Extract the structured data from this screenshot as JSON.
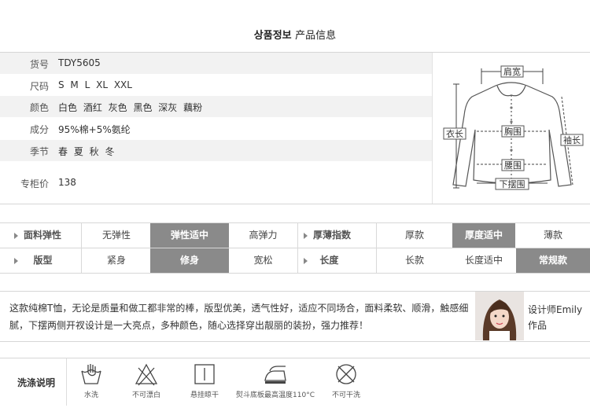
{
  "title": {
    "main": "상품정보",
    "sub": "产品信息"
  },
  "info": [
    {
      "label": "货号",
      "value": "TDY5605"
    },
    {
      "label": "尺码",
      "value": "S M L XL XXL"
    },
    {
      "label": "颜色",
      "value": "白色 酒红 灰色 黑色 深灰 藕粉"
    },
    {
      "label": "成分",
      "value": "95%棉+5%氨纶"
    },
    {
      "label": "季节",
      "value": "春 夏 秋 冬"
    },
    {
      "label": "专柜价",
      "value": "138"
    }
  ],
  "diagram": {
    "shoulder": "肩宽",
    "length": "衣长",
    "chest": "胸围",
    "sleeve": "袖长",
    "waist": "腰围",
    "hem": "下摆围"
  },
  "attributes": {
    "row1": {
      "left_head": "面料弹性",
      "left_options": [
        "无弹性",
        "弹性适中",
        "高弹力"
      ],
      "right_head": "厚薄指数",
      "right_options": [
        "厚款",
        "厚度适中",
        "薄款"
      ]
    },
    "row2": {
      "left_head": "版型",
      "left_options": [
        "紧身",
        "修身",
        "宽松"
      ],
      "right_head": "长度",
      "right_options": [
        "长款",
        "长度适中",
        "常规款"
      ]
    }
  },
  "description": {
    "text": "这款纯棉T恤，无论是质量和做工都非常的棒，版型优美，透气性好，适应不同场合，面料柔软、顺滑，触感细腻，下摆两侧开衩设计是一大亮点，多种颜色，随心选择穿出靓丽的装扮，强力推荐！",
    "designer_line1": "设计师Emily",
    "designer_line2": "作品"
  },
  "wash": {
    "title": "洗涤说明",
    "items": [
      {
        "icon": "hand-wash-icon",
        "label": "水洗"
      },
      {
        "icon": "no-bleach-icon",
        "label": "不可漂白"
      },
      {
        "icon": "hang-dry-icon",
        "label": "悬挂晾干"
      },
      {
        "icon": "iron-icon",
        "label": "熨斗底板最高温度110°C"
      },
      {
        "icon": "no-dry-clean-icon",
        "label": "不可干洗"
      }
    ]
  }
}
